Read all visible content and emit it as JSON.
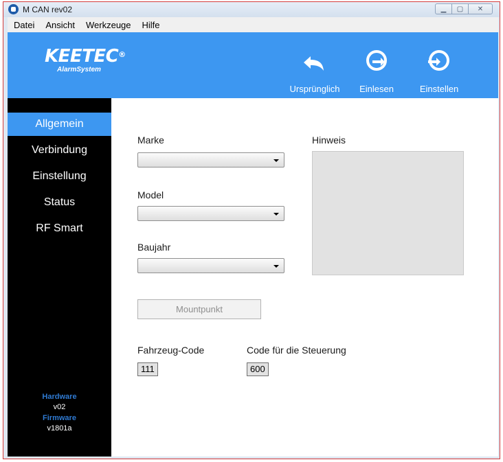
{
  "window": {
    "title": "M CAN rev02"
  },
  "menu": [
    "Datei",
    "Ansicht",
    "Werkzeuge",
    "Hilfe"
  ],
  "header": {
    "logo_main": "KEETEC",
    "logo_reg": "®",
    "logo_sub": "AlarmSystem",
    "buttons": [
      "Ursprünglich",
      "Einlesen",
      "Einstellen"
    ]
  },
  "sidebar": {
    "items": [
      "Allgemein",
      "Verbindung",
      "Einstellung",
      "Status",
      "RF Smart"
    ],
    "hardware_label": "Hardware",
    "hardware_value": "v02",
    "firmware_label": "Firmware",
    "firmware_value": "v1801a"
  },
  "form": {
    "marke_label": "Marke",
    "model_label": "Model",
    "baujahr_label": "Baujahr",
    "hinweis_label": "Hinweis",
    "mount_button": "Mountpunkt",
    "fahrzeug_code_label": "Fahrzeug-Code",
    "fahrzeug_code_value": "111",
    "steuerung_code_label": "Code für die Steuerung",
    "steuerung_code_value": "600"
  },
  "colors": {
    "accent": "#3d97f1",
    "sidebar_bg": "#000000",
    "info_label": "#2f7ad2"
  }
}
